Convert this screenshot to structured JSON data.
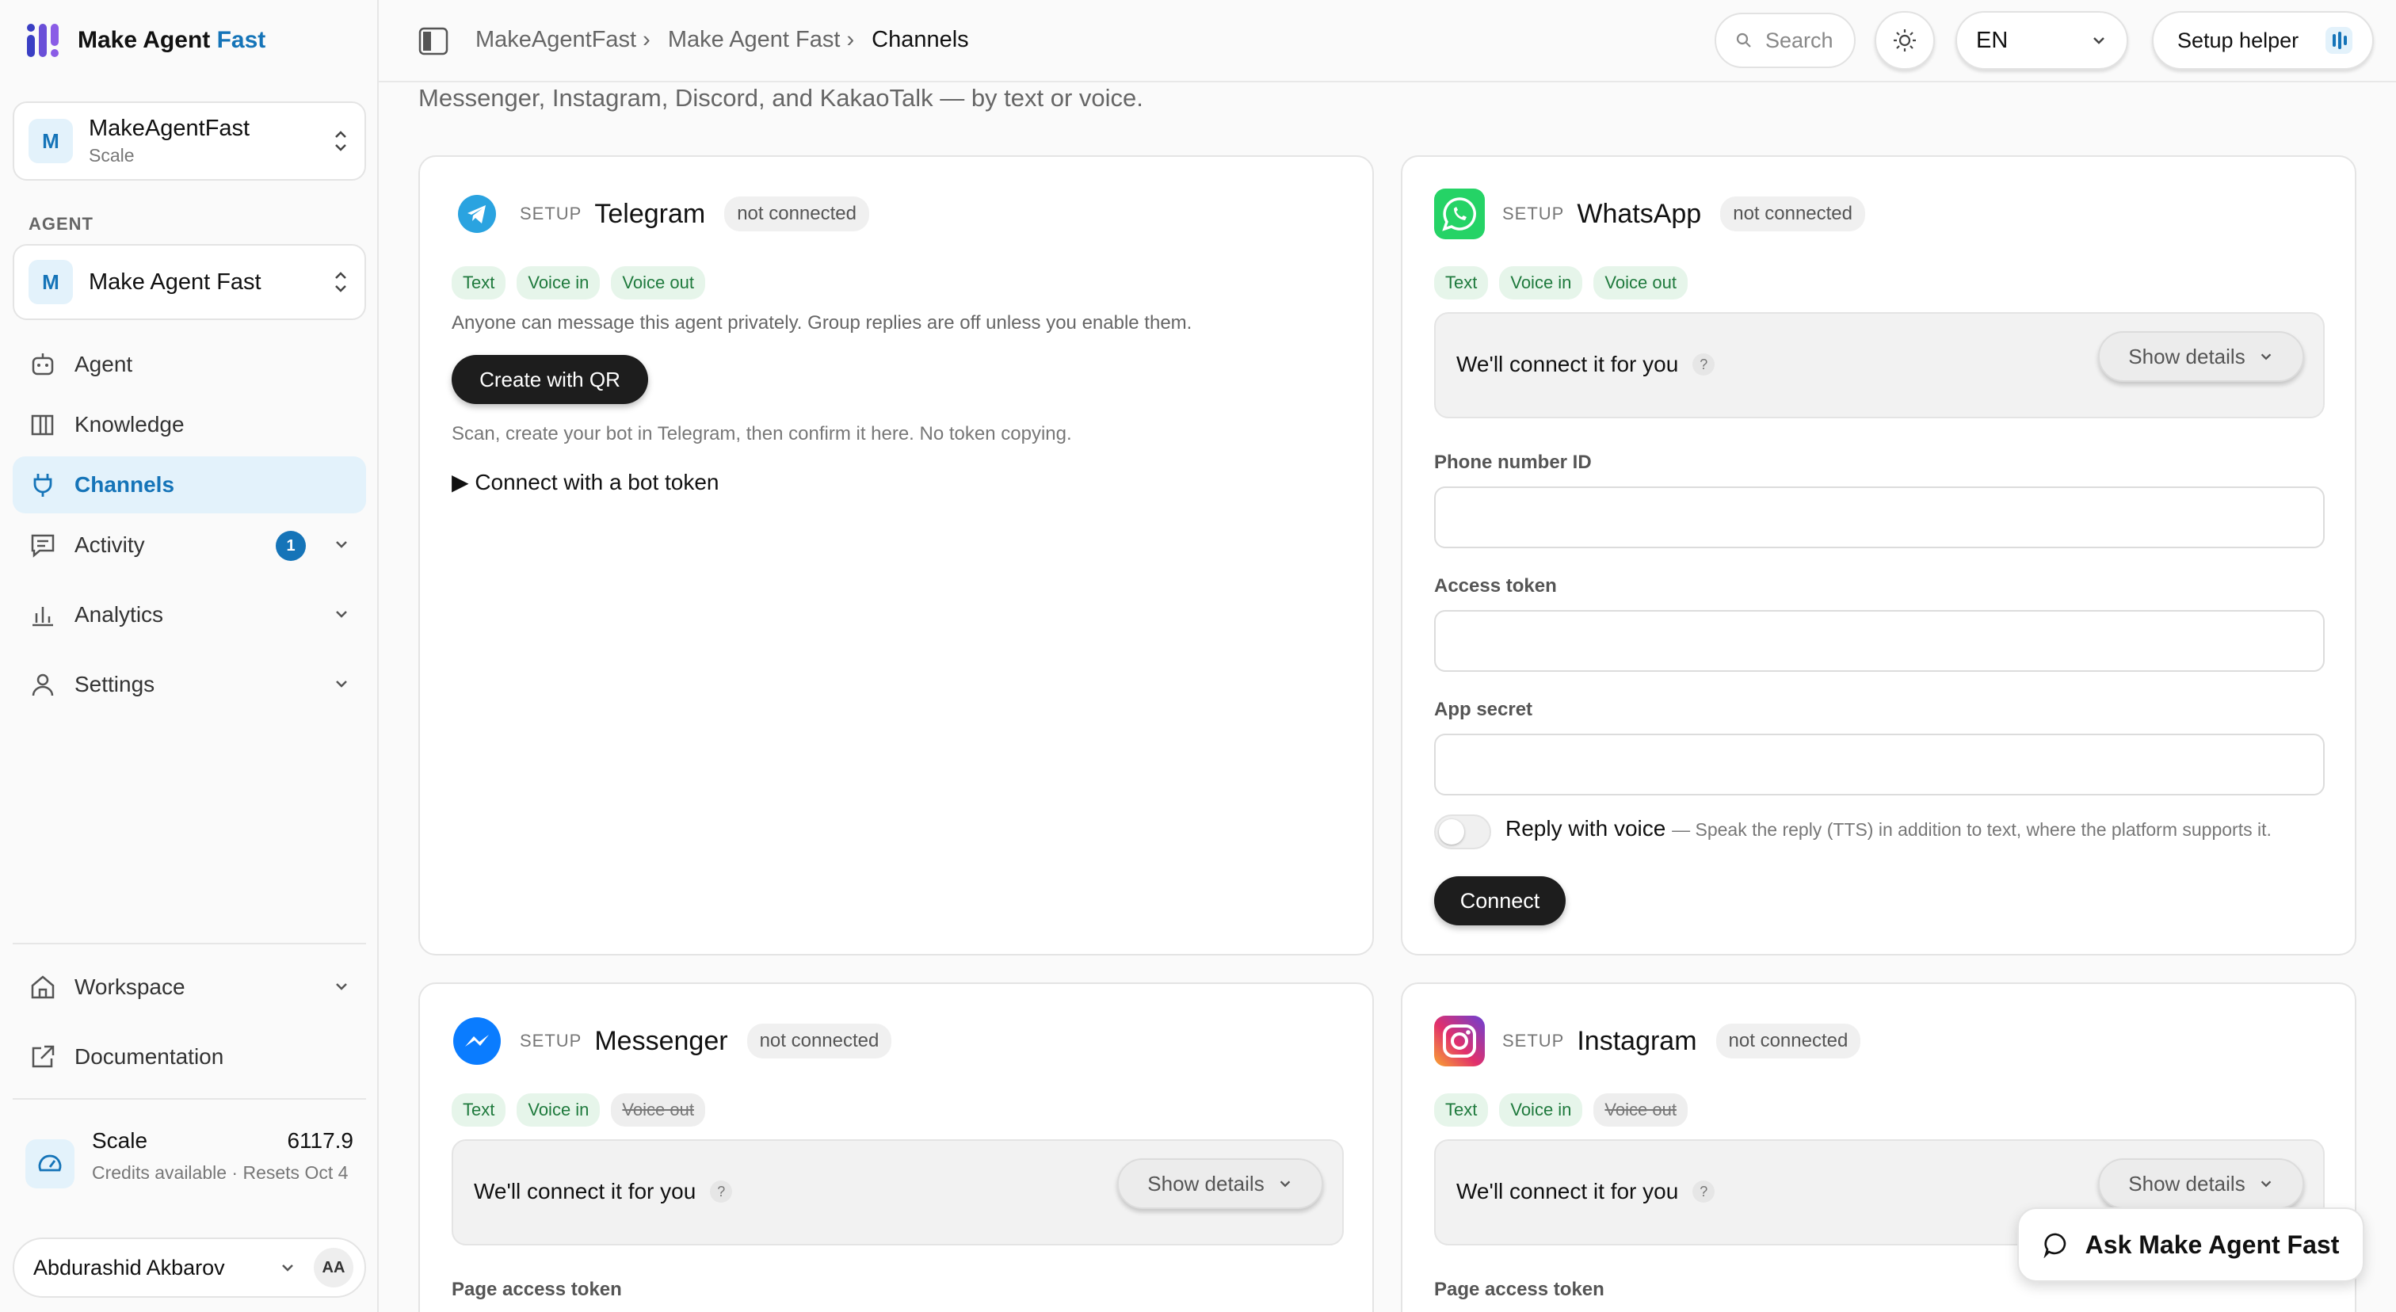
{
  "brand": {
    "name_main": "Make Agent",
    "name_accent": "Fast"
  },
  "workspace_switcher": {
    "initial": "M",
    "title": "MakeAgentFast",
    "subtitle": "Scale"
  },
  "agent_section_label": "AGENT",
  "agent_switcher": {
    "initial": "M",
    "title": "Make Agent Fast"
  },
  "nav": {
    "agent": "Agent",
    "knowledge": "Knowledge",
    "channels": "Channels",
    "activity": "Activity",
    "activity_badge": "1",
    "analytics": "Analytics",
    "settings": "Settings",
    "workspace": "Workspace",
    "documentation": "Documentation"
  },
  "plan": {
    "name": "Scale",
    "credits": "6117.9",
    "subtitle": "Credits available · Resets Oct 4"
  },
  "user": {
    "name": "Abdurashid Akbarov",
    "initials": "AA"
  },
  "breadcrumb": [
    "MakeAgentFast ›",
    "Make Agent Fast ›",
    "Channels"
  ],
  "search": {
    "placeholder": "Search"
  },
  "language": "EN",
  "setup_helper": "Setup helper",
  "intro": "Messenger, Instagram, Discord, and KakaoTalk — by text or voice.",
  "colors": {
    "accent": "#1574b8",
    "telegram": "#2aa3e0",
    "whatsapp": "#25d366",
    "messenger": "#0a7cff"
  },
  "common": {
    "setup": "SETUP",
    "not_connected": "not connected",
    "cap_text": "Text",
    "cap_voice_in": "Voice in",
    "cap_voice_out": "Voice out",
    "assist": "We'll connect it for you",
    "qmark": "?",
    "show_details": "Show details"
  },
  "telegram": {
    "name": "Telegram",
    "description": "Anyone can message this agent privately. Group replies are off unless you enable them.",
    "qr_button": "Create with QR",
    "hint": "Scan, create your bot in Telegram, then confirm it here. No token copying.",
    "token_details": "▶ Connect with a bot token"
  },
  "whatsapp": {
    "name": "WhatsApp",
    "phone_label": "Phone number ID",
    "access_label": "Access token",
    "secret_label": "App secret",
    "voice_label": "Reply with voice",
    "voice_hint": "— Speak the reply (TTS) in addition to text, where the platform supports it.",
    "connect": "Connect"
  },
  "messenger": {
    "name": "Messenger",
    "page_token_label": "Page access token"
  },
  "instagram": {
    "name": "Instagram",
    "page_token_label": "Page access token"
  },
  "ask_button": "Ask Make Agent Fast"
}
